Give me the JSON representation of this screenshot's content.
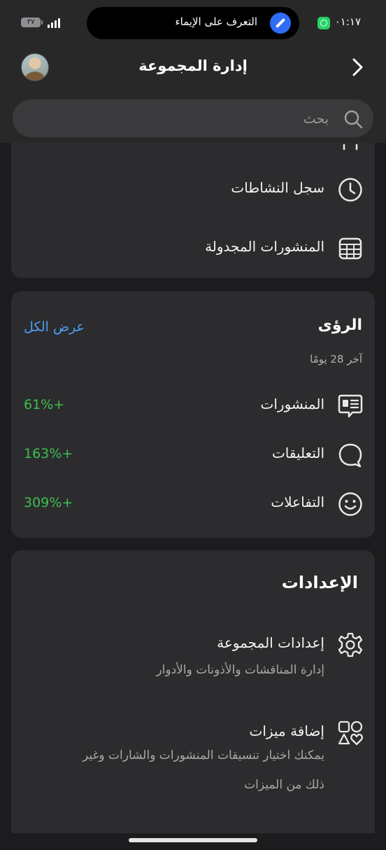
{
  "status": {
    "time": "٠١:١٧",
    "island_text": "التعرف على الإيماء",
    "battery": "٣٧"
  },
  "nav": {
    "title": "إدارة المجموعة"
  },
  "search": {
    "placeholder": "بحث"
  },
  "tools": {
    "items": [
      {
        "label": "سجل النشاطات",
        "icon": "clock-icon"
      },
      {
        "label": "المنشورات المجدولة",
        "icon": "calendar-icon"
      }
    ]
  },
  "insights": {
    "title": "الرؤى",
    "see_all": "عرض الكل",
    "period": "آخر 28 يومًا",
    "stats": [
      {
        "label": "المنشورات",
        "value": "61%+",
        "icon": "posts-icon"
      },
      {
        "label": "التعليقات",
        "value": "163%+",
        "icon": "comment-icon"
      },
      {
        "label": "التفاعلات",
        "value": "309%+",
        "icon": "smile-icon"
      }
    ]
  },
  "settings": {
    "title": "الإعدادات",
    "items": [
      {
        "label": "إعدادات المجموعة",
        "desc": "إدارة المناقشات والأذونات والأدوار",
        "icon": "gear-icon"
      },
      {
        "label": "إضافة ميزات",
        "desc_line1": "يمكنك اختيار تنسيقات المنشورات والشارات وغير",
        "desc_line2": "ذلك من الميزات",
        "icon": "shapes-icon"
      }
    ]
  },
  "colors": {
    "positive": "#3fbf4f",
    "link": "#4c9ff2",
    "card": "#2c2c2e",
    "background": "#1c1c1e"
  }
}
